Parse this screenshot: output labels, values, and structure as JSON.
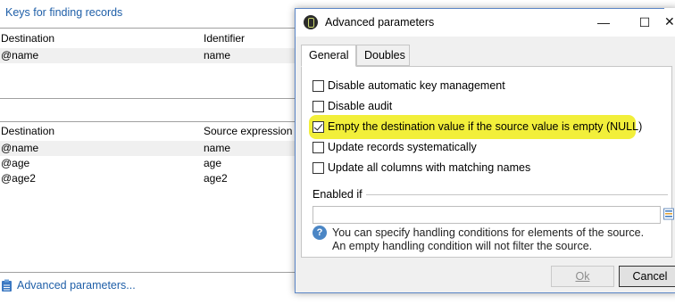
{
  "background": {
    "keys_link": "Keys for finding records",
    "keys_grid": {
      "headers": [
        "Destination",
        "Identifier"
      ],
      "rows": [
        [
          "@name",
          "name"
        ]
      ]
    },
    "mapping_grid": {
      "headers": [
        "Destination",
        "Source expression"
      ],
      "rows": [
        [
          "@name",
          "name"
        ],
        [
          "@age",
          "age"
        ],
        [
          "@age2",
          "age2"
        ]
      ]
    },
    "advanced_link": "Advanced parameters..."
  },
  "dialog": {
    "title": "Advanced parameters",
    "window_buttons": {
      "minimize": "—",
      "maximize": "☐",
      "close": "✕"
    },
    "tabs": [
      {
        "label": "General",
        "active": true
      },
      {
        "label": "Doubles",
        "active": false
      }
    ],
    "options": [
      {
        "label": "Disable automatic key management",
        "checked": false
      },
      {
        "label": "Disable audit",
        "checked": false
      },
      {
        "label": "Empty the destination value if the source value is empty (NULL)",
        "checked": true,
        "highlighted": true
      },
      {
        "label": "Update records systematically",
        "checked": false
      },
      {
        "label": "Update all columns with matching names",
        "checked": false
      }
    ],
    "enabled_if": {
      "label": "Enabled if",
      "value": ""
    },
    "info": {
      "line1": "You can specify handling conditions for elements of the source.",
      "line2": "An empty handling condition will not filter the source."
    },
    "buttons": {
      "ok": "Ok",
      "cancel": "Cancel"
    }
  },
  "colors": {
    "link": "#1f5fa8",
    "highlight": "#f2ef3a",
    "info_icon": "#4b86c5"
  }
}
